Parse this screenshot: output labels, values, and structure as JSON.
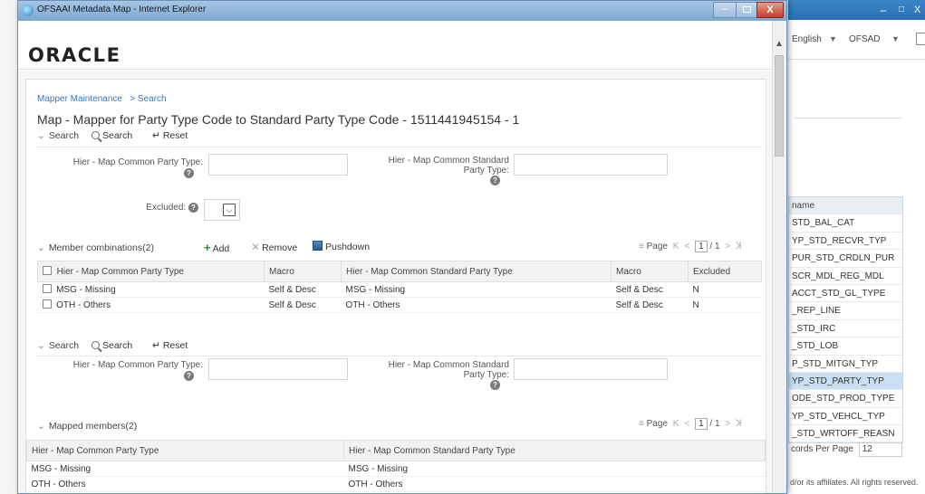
{
  "window": {
    "title": "OFSAAI Metadata Map - Internet Explorer",
    "min": "–",
    "close": "X"
  },
  "logo": "ORACLE",
  "breadcrumb": {
    "parent": "Mapper Maintenance",
    "sep": ">",
    "current": "Search"
  },
  "page_title": "Map - Mapper for Party Type Code to Standard Party Type Code - 1511441945154 - 1",
  "search1": {
    "toggle": "Search",
    "search_label": "Search",
    "reset_label": "Reset",
    "field1_label": "Hier - Map Common Party Type:",
    "field2_label_line1": "Hier - Map Common Standard",
    "field2_label_line2": "Party Type:",
    "excluded_label": "Excluded:",
    "excluded_value": ""
  },
  "member_combinations": {
    "title": "Member combinations(2)",
    "add_label": "Add",
    "remove_label": "Remove",
    "pushdown_label": "Pushdown",
    "pager": {
      "label": "Page",
      "current": "1",
      "total": "/ 1"
    },
    "columns": [
      "Hier - Map Common Party Type",
      "Macro",
      "Hier - Map Common Standard Party Type",
      "Macro",
      "Excluded"
    ],
    "rows": [
      [
        "MSG - Missing",
        "Self & Desc",
        "MSG - Missing",
        "Self & Desc",
        "N"
      ],
      [
        "OTH - Others",
        "Self & Desc",
        "OTH - Others",
        "Self & Desc",
        "N"
      ]
    ]
  },
  "search2": {
    "toggle": "Search",
    "search_label": "Search",
    "reset_label": "Reset",
    "field1_label": "Hier - Map Common Party Type:",
    "field2_label_line1": "Hier - Map Common Standard",
    "field2_label_line2": "Party Type:"
  },
  "mapped_members": {
    "title": "Mapped members(2)",
    "pager": {
      "label": "Page",
      "current": "1",
      "total": "/ 1"
    },
    "columns": [
      "Hier - Map Common Party Type",
      "Hier - Map Common Standard Party Type"
    ],
    "rows": [
      [
        "MSG - Missing",
        "MSG - Missing"
      ],
      [
        "OTH - Others",
        "OTH - Others"
      ]
    ]
  },
  "background": {
    "min": "–",
    "max": "□",
    "close": "X",
    "language": "English",
    "user": "OFSAD",
    "list_header": "name",
    "list_items": [
      "STD_BAL_CAT",
      "YP_STD_RECVR_TYP",
      "PUR_STD_CRDLN_PUR",
      "SCR_MDL_REG_MDL",
      "ACCT_STD_GL_TYPE",
      "_REP_LINE",
      "_STD_IRC",
      "_STD_LOB",
      "P_STD_MITGN_TYP",
      "YP_STD_PARTY_TYP",
      "ODE_STD_PROD_TYPE",
      "YP_STD_VEHCL_TYP",
      "_STD_WRTOFF_REASN"
    ],
    "selected_index": 9,
    "records_label": "cords Per Page",
    "records_value": "12",
    "footer": "d/or its affiliates. All rights reserved."
  }
}
